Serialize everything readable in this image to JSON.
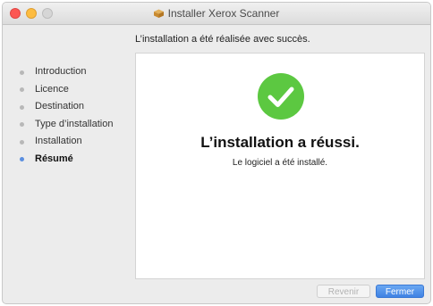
{
  "window": {
    "title": "Installer Xerox Scanner"
  },
  "subheading": "L’installation a été réalisée avec succès.",
  "sidebar": {
    "items": [
      {
        "label": "Introduction",
        "active": false
      },
      {
        "label": "Licence",
        "active": false
      },
      {
        "label": "Destination",
        "active": false
      },
      {
        "label": "Type d’installation",
        "active": false
      },
      {
        "label": "Installation",
        "active": false
      },
      {
        "label": "Résumé",
        "active": true
      }
    ]
  },
  "main": {
    "icon": "checkmark-circle-icon",
    "headline": "L’installation a réussi.",
    "message": "Le logiciel a été installé."
  },
  "buttons": {
    "back_label": "Revenir",
    "back_enabled": false,
    "close_label": "Fermer"
  },
  "colors": {
    "success_green": "#5cc841",
    "accent_blue": "#4a8ce6"
  }
}
